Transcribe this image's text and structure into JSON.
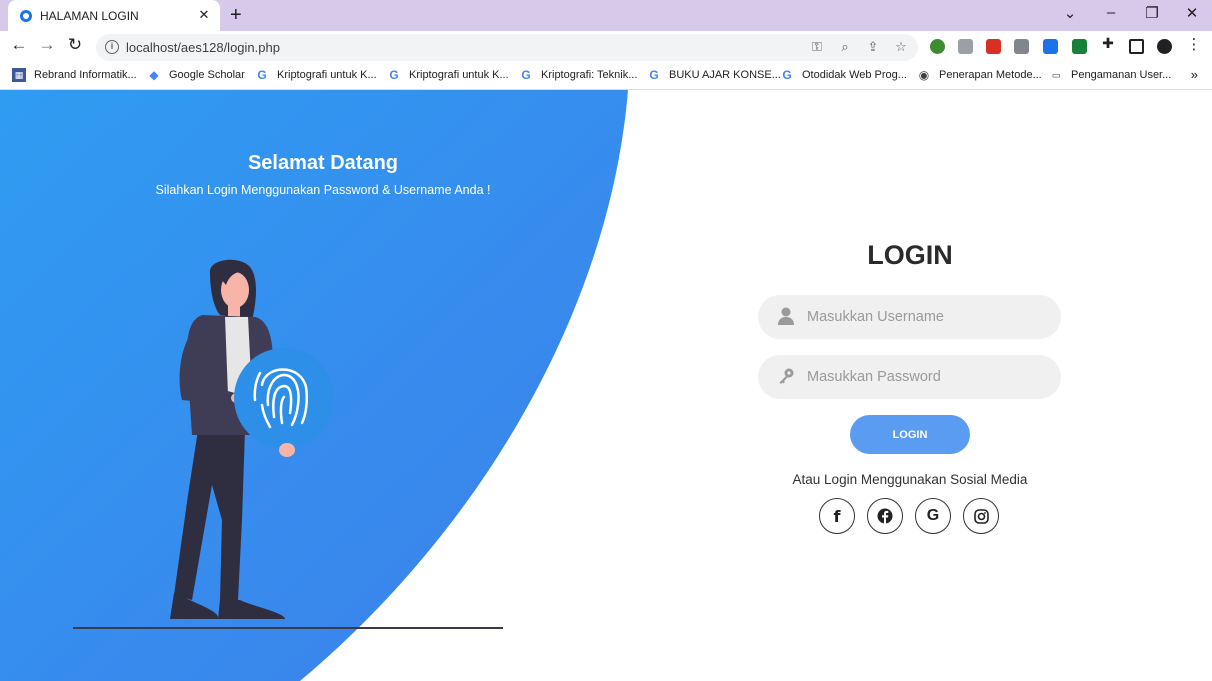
{
  "browser": {
    "tab_title": "HALAMAN LOGIN",
    "url": "localhost/aes128/login.php",
    "bookmarks": [
      {
        "label": "Rebrand Informatik...",
        "icon": "calendar-icon"
      },
      {
        "label": "Google Scholar",
        "icon": "scholar-icon"
      },
      {
        "label": "Kriptografi untuk K...",
        "icon": "google-icon"
      },
      {
        "label": "Kriptografi untuk K...",
        "icon": "google-icon"
      },
      {
        "label": "Kriptografi: Teknik...",
        "icon": "google-icon"
      },
      {
        "label": "BUKU AJAR KONSE...",
        "icon": "google-icon"
      },
      {
        "label": "Otodidak Web Prog...",
        "icon": "google-icon"
      },
      {
        "label": "Penerapan Metode...",
        "icon": "globe-icon"
      },
      {
        "label": "Pengamanan User...",
        "icon": "site-icon"
      }
    ]
  },
  "welcome": {
    "title": "Selamat Datang",
    "subtitle": "Silahkan Login Menggunakan Password & Username Anda !"
  },
  "login": {
    "title": "LOGIN",
    "username_placeholder": "Masukkan Username",
    "password_placeholder": "Masukkan Password",
    "button_label": "LOGIN",
    "social_text": "Atau Login Menggunakan Sosial Media",
    "social": [
      "facebook-icon",
      "facebook-circle-icon",
      "google-icon",
      "instagram-icon"
    ]
  },
  "colors": {
    "accent": "#3b8ef0",
    "button": "#5a9cf2",
    "field_bg": "#f0f0f0",
    "tab_bar": "#d7c9ea"
  }
}
